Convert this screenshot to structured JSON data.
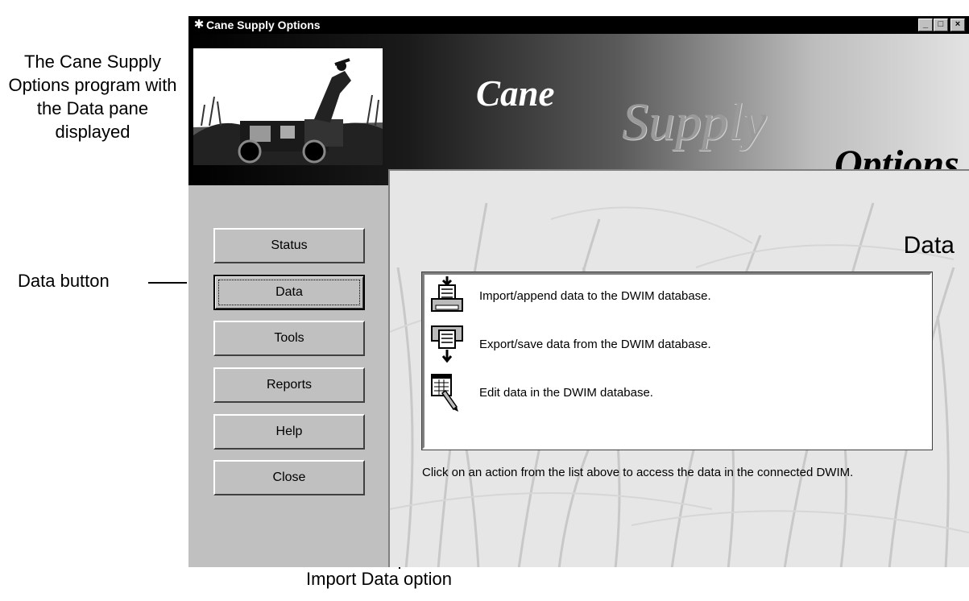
{
  "captions": {
    "main": "The Cane Supply Options program with the Data pane displayed",
    "data_button": "Data button",
    "import_option": "Import Data option"
  },
  "window": {
    "title": "Cane Supply Options",
    "controls": {
      "minimize": "_",
      "maximize": "□",
      "close": "×"
    }
  },
  "header": {
    "title_word1": "Cane",
    "title_word2": "Supply",
    "title_word3": "Options"
  },
  "nav": {
    "buttons": [
      {
        "label": "Status",
        "accel": "S"
      },
      {
        "label": "Data",
        "accel": "D",
        "active": true
      },
      {
        "label": "Tools",
        "accel": "T"
      },
      {
        "label": "Reports",
        "accel": "R"
      },
      {
        "label": "Help",
        "accel": "H"
      },
      {
        "label": "Close",
        "accel": "C"
      }
    ]
  },
  "pane": {
    "heading": "Data",
    "actions": [
      {
        "label": "Import/append data to the DWIM database.",
        "icon": "import-database-icon"
      },
      {
        "label": "Export/save data from the DWIM database.",
        "icon": "export-database-icon"
      },
      {
        "label": "Edit data in the DWIM database.",
        "icon": "edit-data-icon"
      }
    ],
    "instructions": "Click on an action from the list above to access the data in the connected DWIM."
  }
}
